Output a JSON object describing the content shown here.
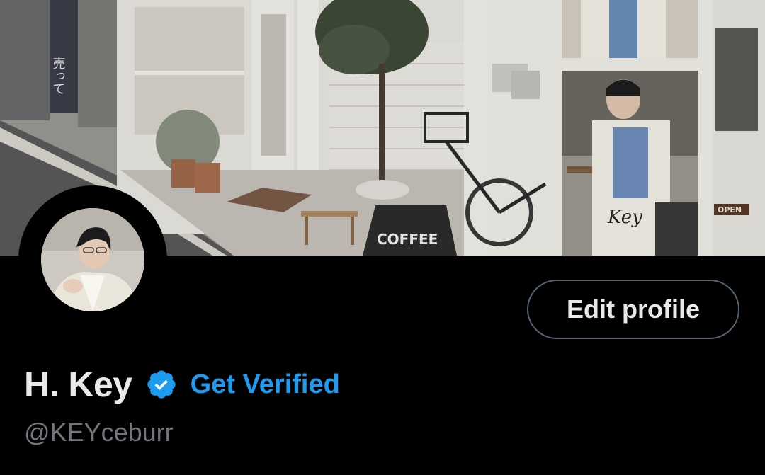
{
  "banner": {
    "sign_text": "COFFEE",
    "open_sign": "OPEN",
    "signature": "Key",
    "vertical_sign": "売って"
  },
  "profile": {
    "display_name": "H. Key",
    "handle": "@KEYceburr",
    "get_verified_label": "Get Verified",
    "edit_profile_label": "Edit profile"
  },
  "icons": {
    "verified": "verified-badge-icon"
  },
  "colors": {
    "background": "#000000",
    "primary_text": "#e7e9ea",
    "secondary_text": "#71767b",
    "accent": "#1d9bf0",
    "button_border": "#536471"
  }
}
